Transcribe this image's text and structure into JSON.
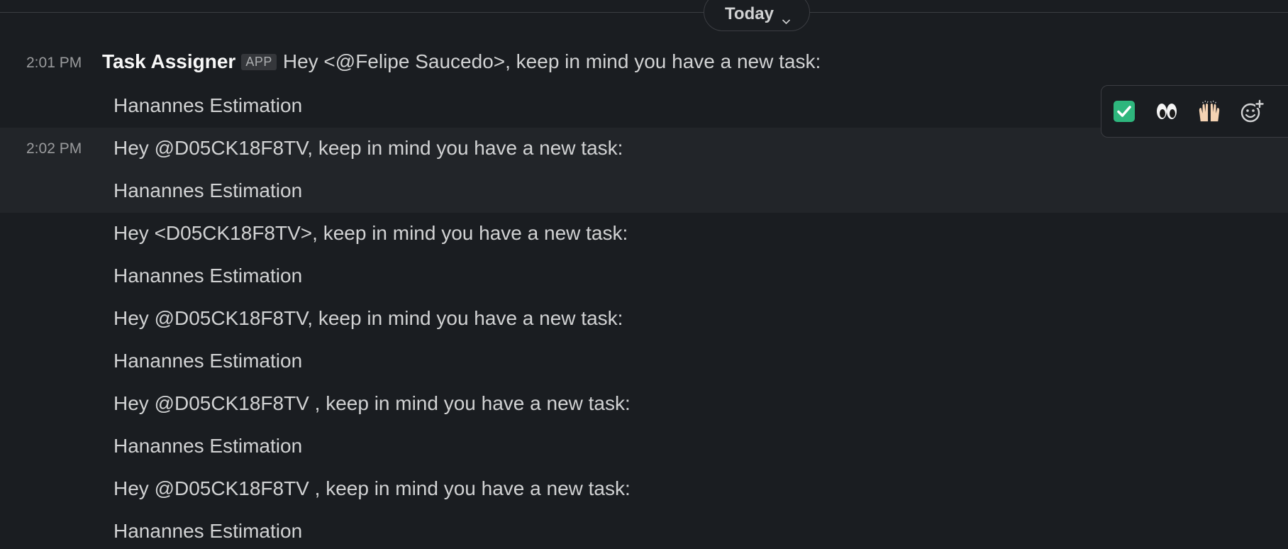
{
  "divider": {
    "date_label": "Today"
  },
  "messages": [
    {
      "time": "2:01 PM",
      "sender": "Task Assigner",
      "badge": "APP",
      "text": "Hey <@Felipe Saucedo>, keep in mind you have a new task:"
    }
  ],
  "lines": [
    {
      "text": "Hanannes Estimation"
    },
    {
      "time": "2:02 PM",
      "text": "Hey @D05CK18F8TV, keep in mind you have a new task:"
    },
    {
      "text": "Hanannes Estimation"
    },
    {
      "text": "Hey <D05CK18F8TV>, keep in mind you have a new task:"
    },
    {
      "text": "Hanannes Estimation"
    },
    {
      "text": "Hey @D05CK18F8TV, keep in mind you have a new task:"
    },
    {
      "text": "Hanannes Estimation"
    },
    {
      "text": "Hey @D05CK18F8TV , keep in mind you have a new task:"
    },
    {
      "text": "Hanannes Estimation"
    },
    {
      "text": "Hey @D05CK18F8TV , keep in mind you have a new task:"
    },
    {
      "text": "Hanannes Estimation"
    }
  ],
  "reaction_toolbar": {
    "items": [
      {
        "icon": "white-check-mark-icon",
        "color": "#2eb67d"
      },
      {
        "icon": "eyes-icon"
      },
      {
        "icon": "raised-hands-icon"
      },
      {
        "icon": "add-reaction-icon"
      }
    ]
  },
  "colors": {
    "background": "#1a1d21",
    "hover_row": "#222529",
    "text": "#d1d2d3",
    "muted": "#9a9b9d"
  }
}
